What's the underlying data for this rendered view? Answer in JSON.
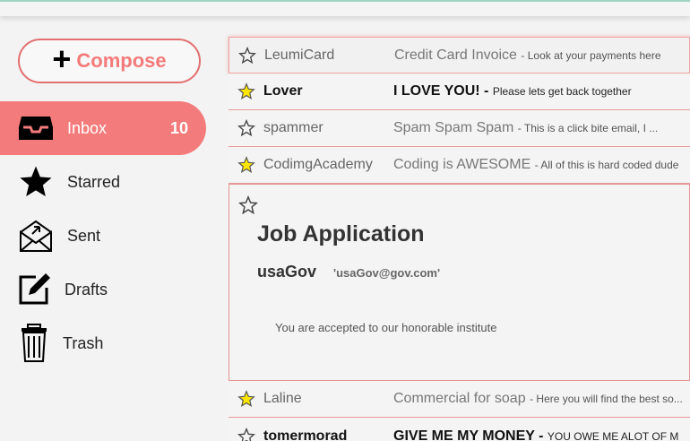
{
  "compose": {
    "label": "Compose"
  },
  "nav": [
    {
      "name": "inbox",
      "label": "Inbox",
      "count": "10",
      "icon": "inbox-icon",
      "active": true
    },
    {
      "name": "starred",
      "label": "Starred",
      "icon": "star-icon"
    },
    {
      "name": "sent",
      "label": "Sent",
      "icon": "sent-envelope-icon"
    },
    {
      "name": "drafts",
      "label": "Drafts",
      "icon": "edit-icon"
    },
    {
      "name": "trash",
      "label": "Trash",
      "icon": "trash-icon"
    }
  ],
  "emails": [
    {
      "sender": "LeumiCard",
      "subject": "Credit Card Invoice",
      "snippet": "Look at your payments here",
      "starred": false,
      "unread": false
    },
    {
      "sender": "Lover",
      "subject": "I LOVE YOU!",
      "snippet": "Please lets get back together",
      "starred": true,
      "unread": true
    },
    {
      "sender": "spammer",
      "subject": "Spam Spam Spam",
      "snippet": "This is a click bite email, I ...",
      "starred": false,
      "unread": false
    },
    {
      "sender": "CodimgAcademy",
      "subject": "Coding is AWESOME",
      "snippet": "All of this is hard coded dude",
      "starred": true,
      "unread": false
    }
  ],
  "expanded": {
    "subject": "Job Application",
    "sender": "usaGov",
    "email": "'usaGov@gov.com'",
    "body": "You are accepted to our honorable institute",
    "starred": false
  },
  "emails_after": [
    {
      "sender": "Laline",
      "subject": "Commercial for soap",
      "snippet": "Here you will find the best so...",
      "starred": true,
      "unread": false
    },
    {
      "sender": "tomermorad",
      "subject": "GIVE ME MY MONEY",
      "snippet": "YOU OWE ME ALOT OF M",
      "starred": false,
      "unread": true
    }
  ],
  "colors": {
    "accent": "#f47b7b",
    "star_fill": "#ffe600",
    "divider": "#e69a9a"
  }
}
